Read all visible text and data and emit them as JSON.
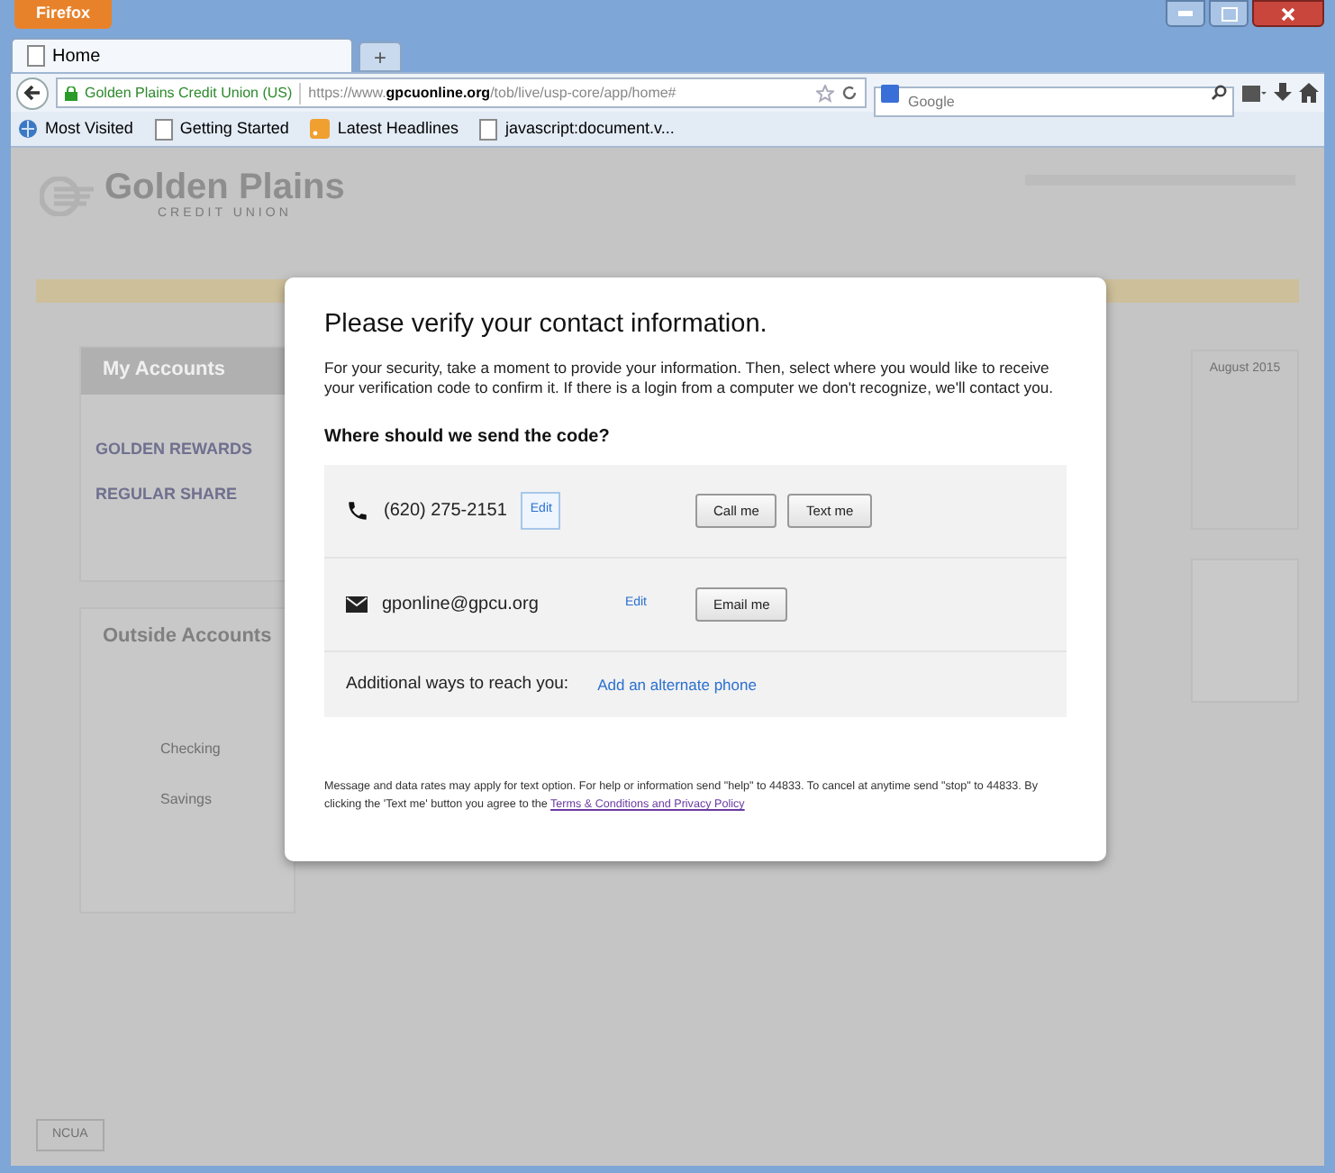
{
  "browser": {
    "app_menu": "Firefox",
    "tabs": [
      {
        "label": "Home",
        "selected": true
      }
    ],
    "new_tab": "+",
    "site_identity": "Golden Plains Credit Union (US)",
    "url_prefix": "https://www.",
    "url_domain": "gpcuonline.org",
    "url_path": "/tob/live/usp-core/app/home#",
    "search_placeholder": "Google",
    "bookmarks": [
      {
        "label": "Most Visited",
        "kind": "folder"
      },
      {
        "label": "Getting Started",
        "kind": "page"
      },
      {
        "label": "Latest Headlines",
        "kind": "feed"
      },
      {
        "label": "javascript:document.v...",
        "kind": "page"
      }
    ]
  },
  "background": {
    "logo": "Golden Plains",
    "logo_sub": "CREDIT UNION",
    "sidebar_title": "My Accounts",
    "accounts": [
      "GOLDEN REWARDS",
      "REGULAR SHARE"
    ],
    "outside_title": "Outside Accounts",
    "outside_items": [
      "Checking",
      "Savings"
    ],
    "calendar_month": "August 2015",
    "badge": "NCUA"
  },
  "dialog": {
    "title": "Please verify your contact information.",
    "intro": "For your security, take a moment to provide your information. Then, select where you would like to receive your verification code to confirm it. If there is a login from a computer we don't recognize, we'll contact you.",
    "question": "Where should we send the code?",
    "contacts": [
      {
        "kind": "phone",
        "value": "(620) 275-2151",
        "edit": "Edit",
        "focused": true,
        "actions": [
          "Call me",
          "Text me"
        ]
      },
      {
        "kind": "email",
        "value": "gponline@gpcu.org",
        "edit": "Edit",
        "focused": false,
        "actions": [
          "Email me"
        ]
      }
    ],
    "additional": {
      "label": "Additional ways to reach you:",
      "link": "Add an alternate phone"
    },
    "disclaimer": "Message and data rates may apply for text option. For help or information send \"help\" to 44833. To cancel at anytime send \"stop\" to 44833. By clicking the 'Text me' button you agree to the ",
    "disclaimer_link": "Terms & Conditions and Privacy Policy"
  }
}
